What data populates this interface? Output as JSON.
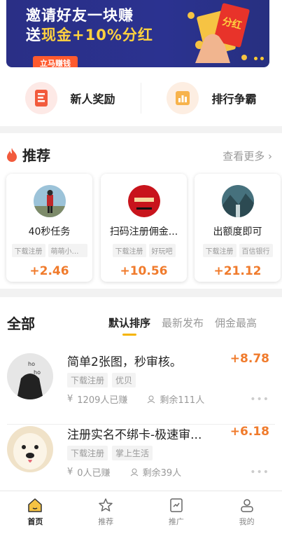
{
  "banner": {
    "line1": "邀请好友一块赚",
    "line2_prefix": "送",
    "line2_highlight": "现金+10%分红",
    "cta": "立马赚钱",
    "envelope_text": "分红"
  },
  "quick_links": [
    {
      "label": "新人奖励",
      "icon": "new-user-reward-icon"
    },
    {
      "label": "排行争霸",
      "icon": "leaderboard-icon"
    }
  ],
  "recommend": {
    "title": "推荐",
    "more": "查看更多",
    "cards": [
      {
        "title": "40秒任务",
        "tags": [
          "下载注册",
          "萌萌小苹..."
        ],
        "price": "+2.46"
      },
      {
        "title": "扫码注册佣金...",
        "tags": [
          "下载注册",
          "好玩吧"
        ],
        "price": "+10.56"
      },
      {
        "title": "出额度即可",
        "tags": [
          "下载注册",
          "百信银行"
        ],
        "price": "+21.12"
      }
    ]
  },
  "all": {
    "title": "全部",
    "sorts": [
      "默认排序",
      "最新发布",
      "佣金最高"
    ],
    "tasks": [
      {
        "title": "简单2张图，秒审核。",
        "price": "+8.78",
        "tags": [
          "下载注册",
          "优贝"
        ],
        "earned": "1209人已赚",
        "remaining": "剩余111人"
      },
      {
        "title": "注册实名不绑卡-极速审...",
        "price": "+6.18",
        "tags": [
          "下载注册",
          "掌上生活"
        ],
        "earned": "0人已赚",
        "remaining": "剩余39人"
      }
    ]
  },
  "tabbar": [
    {
      "label": "首页",
      "icon": "home-icon",
      "active": true
    },
    {
      "label": "推荐",
      "icon": "star-icon",
      "active": false
    },
    {
      "label": "推广",
      "icon": "promote-icon",
      "active": false
    },
    {
      "label": "我的",
      "icon": "profile-icon",
      "active": false
    }
  ],
  "colors": {
    "accent": "#f07b2c",
    "tab_underline": "#f5b400",
    "banner": "#2b3290"
  }
}
